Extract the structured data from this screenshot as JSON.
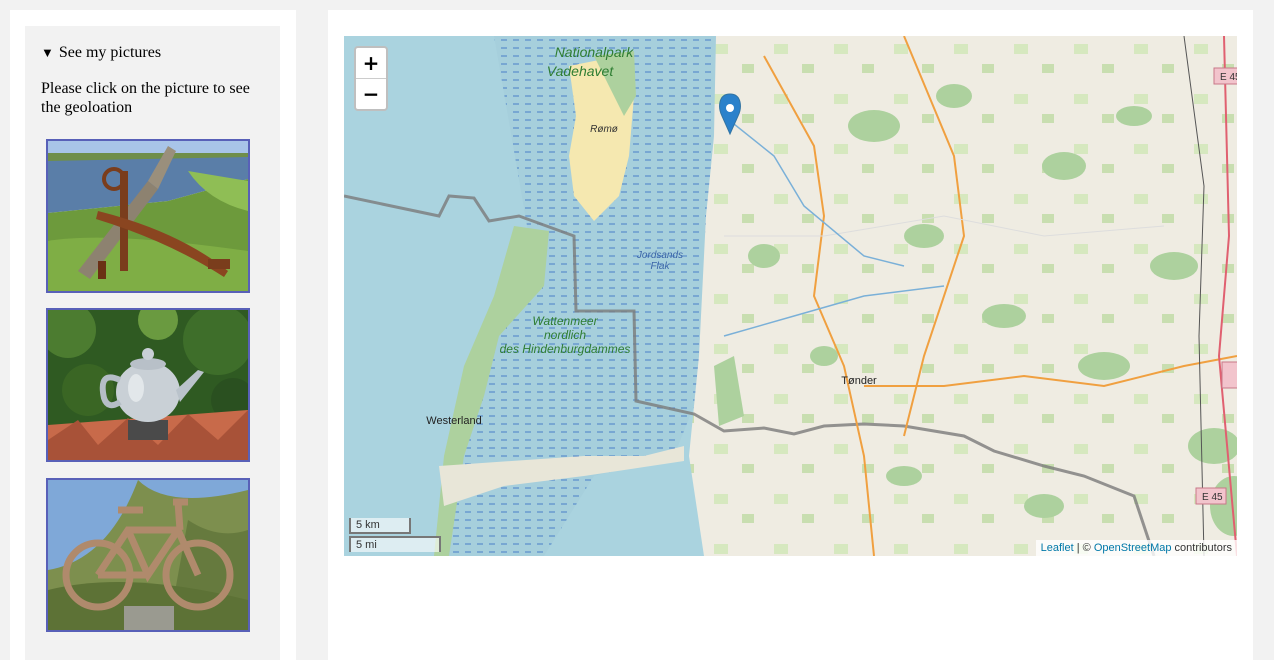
{
  "sidebar": {
    "summary_label": "See my pictures",
    "hint": "Please click on the picture to see the geoloation",
    "pictures": [
      {
        "subject": "anchor"
      },
      {
        "subject": "teapot"
      },
      {
        "subject": "bicycle-sign"
      }
    ]
  },
  "map": {
    "zoom_in": "+",
    "zoom_out": "−",
    "labels": {
      "park": "Nationalpark",
      "park2": "Vadehavet",
      "romo": "Rømø",
      "jordsands1": "Jordsands",
      "jordsands2": "Flak",
      "watt1": "Wattenmeer",
      "watt2": "nordlich",
      "watt3": "des Hindenburgdammes",
      "westerland": "Westerland",
      "tonder": "Tønder",
      "e45a": "E 45",
      "e45b": "E 45"
    },
    "scale_km": "5 km",
    "scale_mi": "5 mi",
    "attribution": {
      "leaflet": "Leaflet",
      "sep": " | © ",
      "osm": "OpenStreetMap",
      "suffix": " contributors"
    },
    "marker_icon": "map-marker-icon",
    "colors": {
      "water": "#aad3df",
      "land": "#f2efe9",
      "green": "#add19e",
      "mud": "#4a7fc8"
    }
  }
}
